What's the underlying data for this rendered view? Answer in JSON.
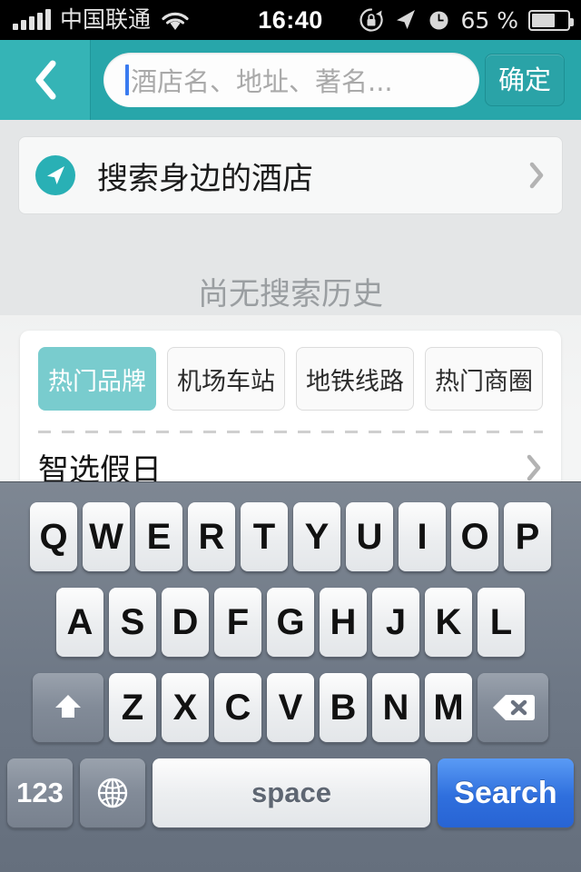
{
  "status_bar": {
    "carrier": "中国联通",
    "time": "16:40",
    "battery_percent": "65 %",
    "battery_level": 65,
    "icons": [
      "signal-bars-icon",
      "wifi-icon",
      "rotation-lock-icon",
      "location-arrow-icon",
      "alarm-clock-icon",
      "battery-icon"
    ]
  },
  "navbar": {
    "back_icon": "chevron-left-icon",
    "search_placeholder": "酒店名、地址、著名...",
    "search_value": "",
    "confirm_label": "确定",
    "bar_color": "#28a6aa",
    "back_button_color": "#35b4b6"
  },
  "content": {
    "nearby": {
      "icon": "navigation-arrow-icon",
      "label": "搜索身边的酒店",
      "accessory_icon": "chevron-right-icon",
      "icon_color": "#29b0b5"
    },
    "empty_history_text": "尚无搜索历史",
    "tabs": [
      {
        "label": "热门品牌",
        "active": true
      },
      {
        "label": "机场车站",
        "active": false
      },
      {
        "label": "地铁线路",
        "active": false
      },
      {
        "label": "热门商圈",
        "active": false
      }
    ],
    "active_tab_color": "#79ccce",
    "brands": [
      {
        "name": "智选假日",
        "accessory_icon": "chevron-right-icon"
      }
    ]
  },
  "keyboard": {
    "row1": [
      "Q",
      "W",
      "E",
      "R",
      "T",
      "Y",
      "U",
      "I",
      "O",
      "P"
    ],
    "row2": [
      "A",
      "S",
      "D",
      "F",
      "G",
      "H",
      "J",
      "K",
      "L"
    ],
    "row3_letters": [
      "Z",
      "X",
      "C",
      "V",
      "B",
      "N",
      "M"
    ],
    "shift_icon": "shift-arrow-up-icon",
    "delete_icon": "backspace-delete-icon",
    "numbers_label": "123",
    "globe_icon": "globe-language-icon",
    "space_label": "space",
    "return_label": "Search",
    "return_color": "#2f6fdd"
  }
}
